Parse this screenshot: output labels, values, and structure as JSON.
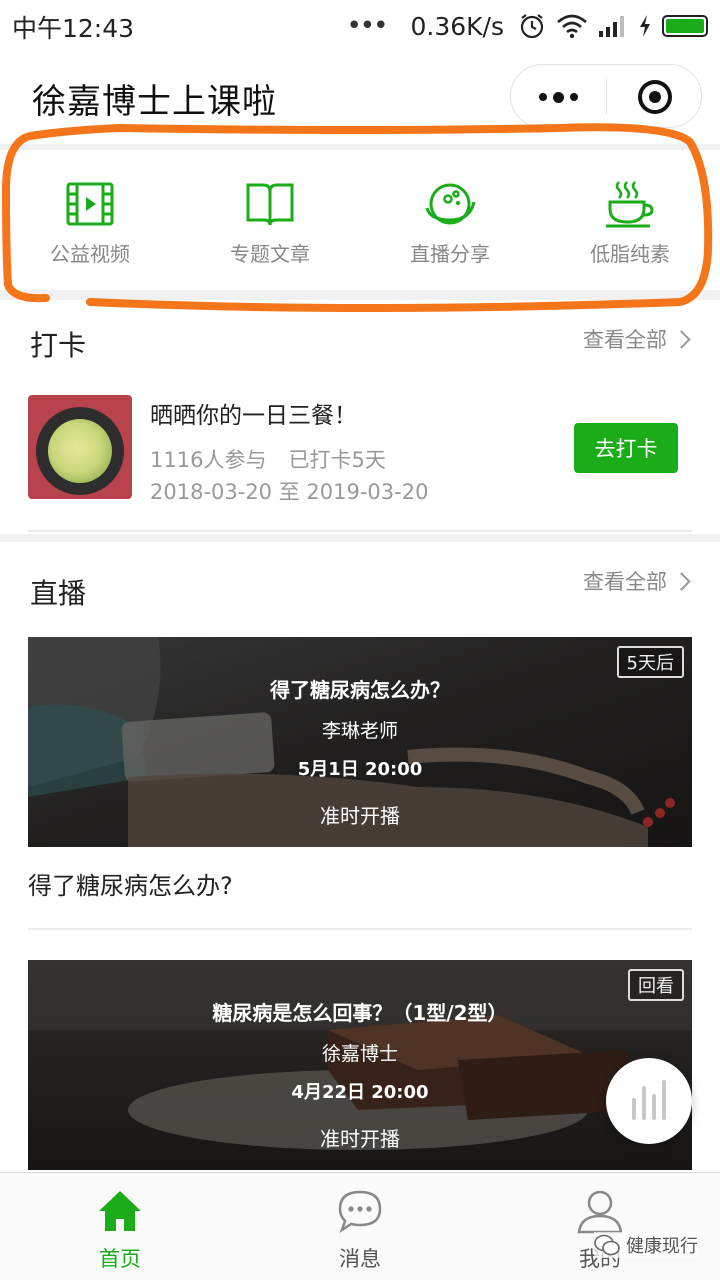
{
  "status_bar": {
    "time": "中午12:43",
    "dots": "•••",
    "speed": "0.36K/s"
  },
  "header": {
    "title": "徐嘉博士上课啦"
  },
  "categories": [
    {
      "label": "公益视频",
      "icon": "video-icon"
    },
    {
      "label": "专题文章",
      "icon": "book-icon"
    },
    {
      "label": "直播分享",
      "icon": "planet-icon"
    },
    {
      "label": "低脂纯素",
      "icon": "tea-cup-icon"
    }
  ],
  "checkin_section": {
    "title": "打卡",
    "see_all": "查看全部",
    "item": {
      "title": "晒晒你的一日三餐！",
      "participants": "1116人参与",
      "streak": "已打卡5天",
      "dates": "2018-03-20 至 2019-03-20",
      "button": "去打卡"
    }
  },
  "live_section": {
    "title": "直播",
    "see_all": "查看全部",
    "items": [
      {
        "title": "得了糖尿病怎么办？",
        "teacher": "李琳老师",
        "time": "5月1日  20:00",
        "status": "准时开播",
        "badge": "5天后",
        "caption": "得了糖尿病怎么办?"
      },
      {
        "title": "糖尿病是怎么回事？（1型/2型）",
        "teacher": "徐嘉博士",
        "time": "4月22日  20:00",
        "status": "准时开播",
        "badge": "回看"
      }
    ]
  },
  "tabbar": {
    "items": [
      {
        "label": "首页",
        "icon": "home-icon",
        "active": true
      },
      {
        "label": "消息",
        "icon": "chat-icon",
        "active": false
      },
      {
        "label": "我的",
        "icon": "user-icon",
        "active": false
      }
    ]
  },
  "watermark": {
    "text": "健康现行"
  },
  "colors": {
    "brand_green": "#1aad19",
    "annotation_orange": "#f5761a"
  }
}
